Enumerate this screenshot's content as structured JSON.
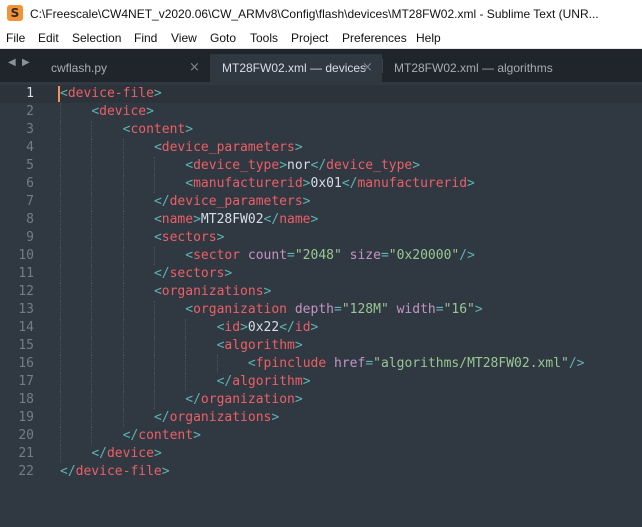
{
  "window": {
    "title": "C:\\Freescale\\CW4NET_v2020.06\\CW_ARMv8\\Config\\flash\\devices\\MT28FW02.xml - Sublime Text (UNR..."
  },
  "menu": [
    "File",
    "Edit",
    "Selection",
    "Find",
    "View",
    "Goto",
    "Tools",
    "Project",
    "Preferences",
    "Help"
  ],
  "tabs": [
    {
      "label": "cwflash.py",
      "active": false
    },
    {
      "label": "MT28FW02.xml — devices",
      "active": true
    },
    {
      "label": "MT28FW02.xml — algorithms",
      "active": false
    }
  ],
  "nav": {
    "back": "◀",
    "forward": "▶"
  },
  "colors": {
    "background": "#303841",
    "tag": "#ec5f67",
    "punct": "#5fb3b3",
    "attr": "#c594c5",
    "string": "#99c794",
    "text": "#d8dee9"
  },
  "editor": {
    "active_line": 1,
    "lines": [
      {
        "n": "1",
        "indent": 0,
        "tokens": [
          [
            "p",
            "<"
          ],
          [
            "t",
            "device-file"
          ],
          [
            "p",
            ">"
          ]
        ]
      },
      {
        "n": "2",
        "indent": 1,
        "tokens": [
          [
            "p",
            "<"
          ],
          [
            "t",
            "device"
          ],
          [
            "p",
            ">"
          ]
        ]
      },
      {
        "n": "3",
        "indent": 2,
        "tokens": [
          [
            "p",
            "<"
          ],
          [
            "t",
            "content"
          ],
          [
            "p",
            ">"
          ]
        ]
      },
      {
        "n": "4",
        "indent": 3,
        "tokens": [
          [
            "p",
            "<"
          ],
          [
            "t",
            "device_parameters"
          ],
          [
            "p",
            ">"
          ]
        ]
      },
      {
        "n": "5",
        "indent": 4,
        "tokens": [
          [
            "p",
            "<"
          ],
          [
            "t",
            "device_type"
          ],
          [
            "p",
            ">"
          ],
          [
            "x",
            "nor"
          ],
          [
            "p",
            "</"
          ],
          [
            "t",
            "device_type"
          ],
          [
            "p",
            ">"
          ]
        ]
      },
      {
        "n": "6",
        "indent": 4,
        "tokens": [
          [
            "p",
            "<"
          ],
          [
            "t",
            "manufacturerid"
          ],
          [
            "p",
            ">"
          ],
          [
            "x",
            "0x01"
          ],
          [
            "p",
            "</"
          ],
          [
            "t",
            "manufacturerid"
          ],
          [
            "p",
            ">"
          ]
        ]
      },
      {
        "n": "7",
        "indent": 3,
        "tokens": [
          [
            "p",
            "</"
          ],
          [
            "t",
            "device_parameters"
          ],
          [
            "p",
            ">"
          ]
        ]
      },
      {
        "n": "8",
        "indent": 3,
        "tokens": [
          [
            "p",
            "<"
          ],
          [
            "t",
            "name"
          ],
          [
            "p",
            ">"
          ],
          [
            "x",
            "MT28FW02"
          ],
          [
            "p",
            "</"
          ],
          [
            "t",
            "name"
          ],
          [
            "p",
            ">"
          ]
        ]
      },
      {
        "n": "9",
        "indent": 3,
        "tokens": [
          [
            "p",
            "<"
          ],
          [
            "t",
            "sectors"
          ],
          [
            "p",
            ">"
          ]
        ]
      },
      {
        "n": "10",
        "indent": 4,
        "tokens": [
          [
            "p",
            "<"
          ],
          [
            "t",
            "sector"
          ],
          [
            "x",
            " "
          ],
          [
            "a",
            "count"
          ],
          [
            "p",
            "="
          ],
          [
            "s",
            "\"2048\""
          ],
          [
            "x",
            " "
          ],
          [
            "a",
            "size"
          ],
          [
            "p",
            "="
          ],
          [
            "s",
            "\"0x20000\""
          ],
          [
            "p",
            "/>"
          ]
        ]
      },
      {
        "n": "11",
        "indent": 3,
        "tokens": [
          [
            "p",
            "</"
          ],
          [
            "t",
            "sectors"
          ],
          [
            "p",
            ">"
          ]
        ]
      },
      {
        "n": "12",
        "indent": 3,
        "tokens": [
          [
            "p",
            "<"
          ],
          [
            "t",
            "organizations"
          ],
          [
            "p",
            ">"
          ]
        ]
      },
      {
        "n": "13",
        "indent": 4,
        "tokens": [
          [
            "p",
            "<"
          ],
          [
            "t",
            "organization"
          ],
          [
            "x",
            " "
          ],
          [
            "a",
            "depth"
          ],
          [
            "p",
            "="
          ],
          [
            "s",
            "\"128M\""
          ],
          [
            "x",
            " "
          ],
          [
            "a",
            "width"
          ],
          [
            "p",
            "="
          ],
          [
            "s",
            "\"16\""
          ],
          [
            "p",
            ">"
          ]
        ]
      },
      {
        "n": "14",
        "indent": 5,
        "tokens": [
          [
            "p",
            "<"
          ],
          [
            "t",
            "id"
          ],
          [
            "p",
            ">"
          ],
          [
            "x",
            "0x22"
          ],
          [
            "p",
            "</"
          ],
          [
            "t",
            "id"
          ],
          [
            "p",
            ">"
          ]
        ]
      },
      {
        "n": "15",
        "indent": 5,
        "tokens": [
          [
            "p",
            "<"
          ],
          [
            "t",
            "algorithm"
          ],
          [
            "p",
            ">"
          ]
        ]
      },
      {
        "n": "16",
        "indent": 6,
        "tokens": [
          [
            "p",
            "<"
          ],
          [
            "t",
            "fpinclude"
          ],
          [
            "x",
            " "
          ],
          [
            "a",
            "href"
          ],
          [
            "p",
            "="
          ],
          [
            "s",
            "\"algorithms/MT28FW02.xml\""
          ],
          [
            "p",
            "/>"
          ]
        ]
      },
      {
        "n": "17",
        "indent": 5,
        "tokens": [
          [
            "p",
            "</"
          ],
          [
            "t",
            "algorithm"
          ],
          [
            "p",
            ">"
          ]
        ]
      },
      {
        "n": "18",
        "indent": 4,
        "tokens": [
          [
            "p",
            "</"
          ],
          [
            "t",
            "organization"
          ],
          [
            "p",
            ">"
          ]
        ]
      },
      {
        "n": "19",
        "indent": 3,
        "tokens": [
          [
            "p",
            "</"
          ],
          [
            "t",
            "organizations"
          ],
          [
            "p",
            ">"
          ]
        ]
      },
      {
        "n": "20",
        "indent": 2,
        "tokens": [
          [
            "p",
            "</"
          ],
          [
            "t",
            "content"
          ],
          [
            "p",
            ">"
          ]
        ]
      },
      {
        "n": "21",
        "indent": 1,
        "tokens": [
          [
            "p",
            "</"
          ],
          [
            "t",
            "device"
          ],
          [
            "p",
            ">"
          ]
        ]
      },
      {
        "n": "22",
        "indent": 0,
        "tokens": [
          [
            "p",
            "</"
          ],
          [
            "t",
            "device-file"
          ],
          [
            "p",
            ">"
          ]
        ]
      }
    ]
  }
}
